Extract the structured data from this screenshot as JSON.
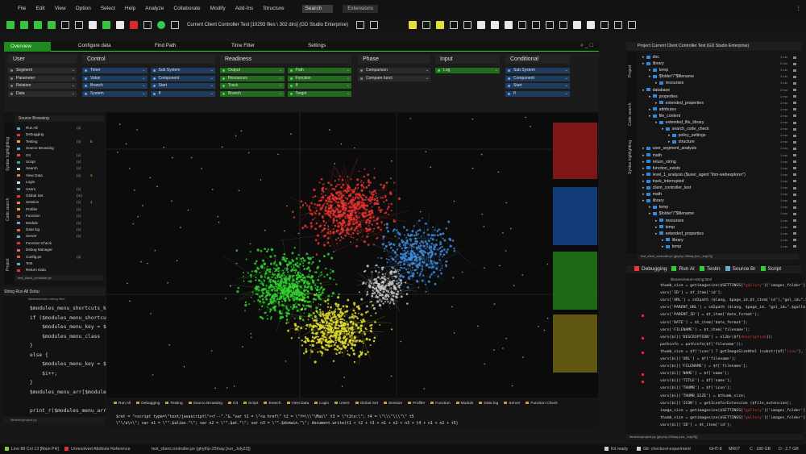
{
  "menu": [
    "File",
    "Edit",
    "View",
    "Option",
    "Select",
    "Help",
    "Analyze",
    "Collaborate",
    "Modify",
    "Add-Ins",
    "Structure"
  ],
  "menu_search": "Search",
  "menu_extensions": "Extensions",
  "toolbar": {
    "title": "Current Client Controller Test [10293 files \\ 302 dirs] (GD Studio Enterprise)"
  },
  "tabs": [
    "Overview",
    "Configure data",
    "Find Path",
    "Time Filter",
    "Settings"
  ],
  "groups": [
    {
      "title": "User",
      "items": [
        "Segment",
        "Parameter",
        "Relation",
        "Data"
      ]
    },
    {
      "title": "Control",
      "items": [
        "Timer",
        "Value",
        "Branch",
        "System",
        "Sub System",
        "Component",
        "Start",
        "If"
      ]
    },
    {
      "title": "Readiness",
      "items": [
        "Output",
        "Resources",
        "Track",
        "Branch",
        "Path",
        "Function",
        "If",
        "Target"
      ]
    },
    {
      "title": "Phase",
      "items": [
        "Comparison",
        "Compare funct"
      ]
    },
    {
      "title": "Input",
      "items": [
        "Log"
      ]
    },
    {
      "title": "Conditional",
      "items": [
        "Sub System",
        "Component",
        "Start",
        "If"
      ]
    }
  ],
  "source_panel": {
    "header": "Source Browsing",
    "vtabs": [
      "Syntax highlighting",
      "Code search",
      "Project"
    ],
    "items": [
      {
        "label": "Run All",
        "r1": "(x)",
        "r2": ""
      },
      {
        "label": "Debugging",
        "r1": "",
        "r2": ""
      },
      {
        "label": "Testing",
        "r1": "(x)",
        "r2": "5"
      },
      {
        "label": "Source Browsing",
        "r1": "",
        "r2": ""
      },
      {
        "label": "Git",
        "r1": "(x)",
        "r2": ""
      },
      {
        "label": "Script",
        "r1": "(x)",
        "r2": ""
      },
      {
        "label": "Search",
        "r1": "(x)",
        "r2": ""
      },
      {
        "label": "View Data",
        "r1": "(x)",
        "r2": "2"
      },
      {
        "label": "Login",
        "r1": "",
        "r2": ""
      },
      {
        "label": "Users",
        "r1": "(x)",
        "r2": ""
      },
      {
        "label": "Global Set",
        "r1": "(m)",
        "r2": ""
      },
      {
        "label": "Session",
        "r1": "(x)",
        "r2": "1"
      },
      {
        "label": "Profiler",
        "r1": "(x)",
        "r2": ""
      },
      {
        "label": "Function",
        "r1": "(x)",
        "r2": ""
      },
      {
        "label": "Module",
        "r1": "(x)",
        "r2": ""
      },
      {
        "label": "Data log",
        "r1": "(x)",
        "r2": ""
      },
      {
        "label": "Server",
        "r1": "(x)",
        "r2": ""
      },
      {
        "label": "Function Check",
        "r1": "",
        "r2": ""
      },
      {
        "label": "Debug Manager",
        "r1": "",
        "r2": ""
      },
      {
        "label": "Config.px",
        "r1": "(x)",
        "r2": ""
      },
      {
        "label": "Test",
        "r1": "",
        "r2": ""
      },
      {
        "label": "Return Data",
        "r1": "",
        "r2": ""
      }
    ],
    "footer": "test_client_controller.px"
  },
  "left_code": {
    "tabs": "String   Run All   Debu",
    "path": "libraries/return-string.html",
    "lines": [
      "$modules_menu_shortcuts_k",
      "if ($modules_menu_shortcuts",
      "    $modules_menu_key = $",
      "    $modules_menu_class",
      "}",
      "else {",
      "    $modules_menu_key = $",
      "    $i++;",
      "}",
      "$modules_menu_arr[$modules",
      "",
      "print_r($modules_menu_arr, SORT_N"
    ],
    "footer": "libraries/project.py"
  },
  "bottom_panel": {
    "tabs": [
      "Run All",
      "Debugging",
      "Testing",
      "Source Browsing",
      "Git",
      "Script",
      "Search",
      "View Data",
      "Login",
      "Users",
      "Global Set",
      "Session",
      "Profiler",
      "Function",
      "Module",
      "Data log",
      "Server",
      "Function Check"
    ],
    "code": [
      "$ret = \"<script type=\\\"text/javascript\\\"><!--\".\"&.\"var t1 = \\\"<a href\\\" t2 = \\\"f=\\\\\\\"\\Mai\\\" t3 = \\\"t1to:\\\"; t4 = \\\"\\\\\\\"\\\\\\\"\\\" t5",
      "\\\"\\/a\\>\\\"; var n1 = \\\"\".$alias.\"\\\"; var n2 = \\\"\".$at.\"\\\"; var n3 = \\\"\".$domain.\"\\\"; document.write(t1 + t2 + t3 + n1 + n2 + n3 + t4 + n1 + n2 + t5)"
    ]
  },
  "tree_panel": {
    "title": "Project Current Client Controller Test (GD Studio Enterprise)",
    "vtabs": [
      "Project",
      "Code search",
      "Syntax highlighting"
    ],
    "items": [
      {
        "indent": 0,
        "label": "doc",
        "size": "1 mo"
      },
      {
        "indent": 0,
        "label": "library",
        "size": "2 mo"
      },
      {
        "indent": 1,
        "label": "temp",
        "size": "1 mo"
      },
      {
        "indent": 1,
        "label": "$folder\"/\"$filename",
        "size": "1 mo"
      },
      {
        "indent": 2,
        "label": "resourses",
        "size": "1 mo"
      },
      {
        "indent": 0,
        "label": "database",
        "size": "2 mo"
      },
      {
        "indent": 1,
        "label": "properties",
        "size": "1 mo"
      },
      {
        "indent": 2,
        "label": "extended_properties",
        "size": "1 mo"
      },
      {
        "indent": 1,
        "label": "attributes",
        "size": "1 mo"
      },
      {
        "indent": 1,
        "label": "file_content",
        "size": "1 mo"
      },
      {
        "indent": 2,
        "label": "extended_file_library",
        "size": "1 mo"
      },
      {
        "indent": 3,
        "label": "search_code_check",
        "size": "1 mo"
      },
      {
        "indent": 4,
        "label": "policy_settings",
        "size": "1 mo"
      },
      {
        "indent": 4,
        "label": "structure",
        "size": "1 mo"
      },
      {
        "indent": 0,
        "label": "user_segment_analysis",
        "size": "1 mo"
      },
      {
        "indent": 0,
        "label": "math",
        "size": "1 mo"
      },
      {
        "indent": 0,
        "label": "return_string",
        "size": "1 mo"
      },
      {
        "indent": 0,
        "label": "function_exists",
        "size": "1 mo"
      },
      {
        "indent": 0,
        "label": "level_1_analysis ($user_agent \"ibm-webexplorer\")",
        "size": "1 mo"
      },
      {
        "indent": 0,
        "label": "track_interrupted",
        "size": "1 mo"
      },
      {
        "indent": 0,
        "label": "client_controller_test",
        "size": "1 mo"
      },
      {
        "indent": 0,
        "label": "math",
        "size": "1 mo"
      },
      {
        "indent": 0,
        "label": "library",
        "size": "1 mo"
      },
      {
        "indent": 1,
        "label": "temp",
        "size": "1 mo"
      },
      {
        "indent": 1,
        "label": "$folder\"/\"$filename",
        "size": "1 mo"
      },
      {
        "indent": 2,
        "label": "resourses",
        "size": "1 mo"
      },
      {
        "indent": 2,
        "label": "temp",
        "size": "1 mo"
      },
      {
        "indent": 2,
        "label": "extended_properties",
        "size": "1 mo"
      },
      {
        "indent": 3,
        "label": "library",
        "size": "1 mo"
      },
      {
        "indent": 3,
        "label": "temp",
        "size": "1 mo"
      }
    ],
    "footer": "test_client_controller.px (ghy/hp-25\\hay [run_July23])"
  },
  "right_code": {
    "tabs": [
      "Debugging",
      "Run Al",
      "Testin",
      "Source Br",
      "Script"
    ],
    "path": "libraries/return-string.html",
    "lines": [
      [
        "thumb_size = getimagesize($SETTINGS['",
        "gallery",
        "']['images_folder'].\"/thumb/\".$t_item"
      ],
      [
        "vars['ID'] = $f_item['id'];"
      ],
      [
        "vars['URL'] = sd2path ($lang, $page_id,$t_item['id'],\"gal_id=\".$gallery_id,\"&amp;gal"
      ],
      [
        "vars['PARENT_URL'] = sd2path ($lang, $page_id, \"gal_id=\".$gallery_id);"
      ],
      [
        "vars['PARENT_ID'] = $t_item['date_format'];"
      ],
      [
        "vars['DATE'] = $t_item['date_format'];"
      ],
      [
        "vars['FILENAME'] = $t_item['filename'];"
      ],
      [
        "vars[$i]['DESCRIPTION'] = nl2br($f[",
        "description",
        "]);"
      ],
      [
        "pathinfo = pathinfo($f['filename']);"
      ],
      [
        "thumb_size = $f['icon'] ? getImageSizeHtml (substr($f['",
        "icon",
        "'], 1)) :"
      ],
      [
        "vars[$i]['URL'] = $f['filename'];"
      ],
      [
        "vars[$i]['FILENAME'] = $f['filename'];"
      ],
      [
        "vars[$i]['NAME'] = $f['name'];"
      ],
      [
        "vars[$i]['TITLE'] = $f['name'];"
      ],
      [
        "vars[$i]['THUMB'] = $f['icon'];"
      ],
      [
        "vars[$i]['THUMB_SIZE'] = $thumb_size;"
      ],
      [
        "vars[$i]['ICON'] = getIconForExtension ($file_extension);"
      ],
      [
        "image_size = getimagesize($SETTINGS['",
        "gallery",
        "']['images_folder'].\"/\".$"
      ],
      [
        "thumb_size = getimagesize($SETTINGS['",
        "gallery",
        "']['images_folder'].\"/thumb/\".$"
      ],
      [
        "vars[$i]['ID'] = $t_item['id'];"
      ]
    ],
    "footer": "libraries/project.py (ghy/hp-25\\hay [run_July23])"
  },
  "status_bar": {
    "line": "Line 89 Col 13 [Main PH]",
    "warning": "Unresolved Attribute Reference",
    "file": "test_client.controller.px (ghy/hp-25\\hay [run_July23])",
    "ready": "Kit ready",
    "git": "Git: checkout-experiment",
    "ghtr": "GHT-8",
    "mr": "MR07",
    "c": "C : 180 GB",
    "d": "D : 2.7 GB"
  },
  "colors": {
    "accent": "#2ad12c",
    "red": "#e02a2a",
    "green": "#2fcf2f",
    "blue": "#3c8ad8",
    "yellow": "#e0d430"
  }
}
